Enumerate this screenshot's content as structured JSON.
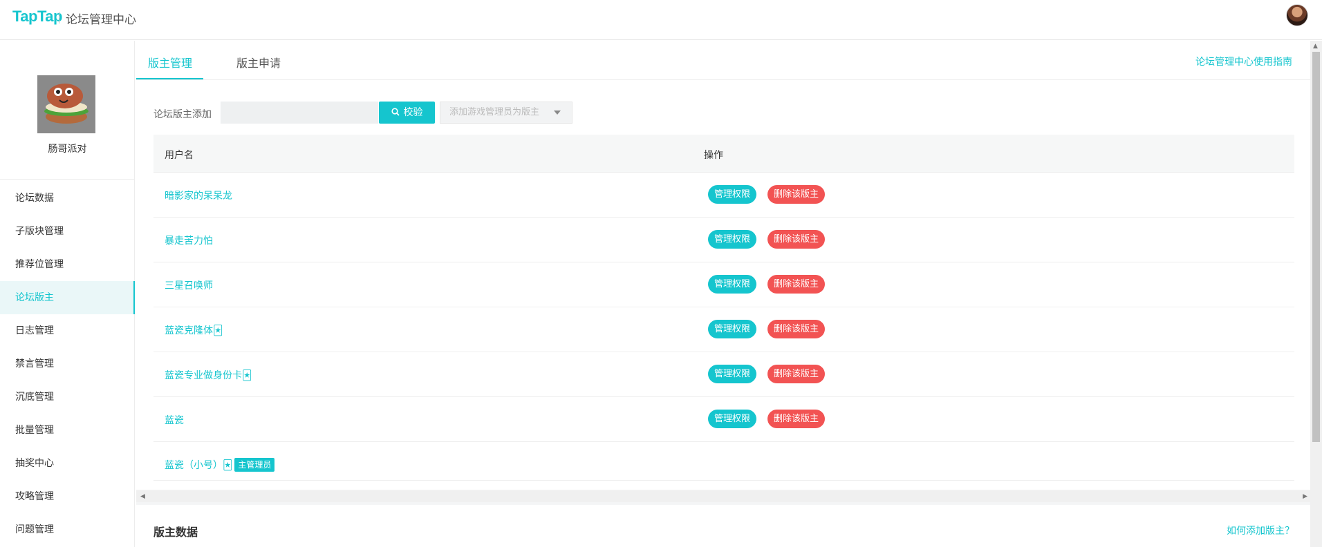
{
  "header": {
    "logo": "TapTap",
    "title": "论坛管理中心"
  },
  "sidebar": {
    "forum_name": "肠哥派对",
    "items": [
      {
        "label": "论坛数据"
      },
      {
        "label": "子版块管理"
      },
      {
        "label": "推荐位管理"
      },
      {
        "label": "论坛版主",
        "active": true
      },
      {
        "label": "日志管理"
      },
      {
        "label": "禁言管理"
      },
      {
        "label": "沉底管理"
      },
      {
        "label": "批量管理"
      },
      {
        "label": "抽奖中心"
      },
      {
        "label": "攻略管理"
      },
      {
        "label": "问题管理"
      }
    ]
  },
  "tabs": [
    {
      "label": "版主管理",
      "active": true
    },
    {
      "label": "版主申请"
    }
  ],
  "guide_link": "论坛管理中心使用指南",
  "add_moderator": {
    "label": "论坛版主添加",
    "input_value": "",
    "verify_label": "校验",
    "game_select_placeholder": "添加游戏管理员为版主"
  },
  "table": {
    "columns": [
      "用户名",
      "操作"
    ],
    "perm_label": "管理权限",
    "delete_label": "删除该版主",
    "rows": [
      {
        "username": "暗影家的呆呆龙",
        "actions": true
      },
      {
        "username": "暴走苦力怕",
        "actions": true
      },
      {
        "username": "三星召唤师",
        "actions": true
      },
      {
        "username": "蓝瓷克隆体🃏",
        "actions": true
      },
      {
        "username": "蓝瓷专业做身份卡🃏",
        "actions": true
      },
      {
        "username": "蓝瓷",
        "actions": true
      },
      {
        "username": "蓝瓷（小号）🃏",
        "badge": "主管理员",
        "actions": false
      }
    ]
  },
  "stats": {
    "title": "版主数据",
    "help_link": "如何添加版主？"
  },
  "colors": {
    "accent": "#15c5ce",
    "danger": "#f25353"
  }
}
